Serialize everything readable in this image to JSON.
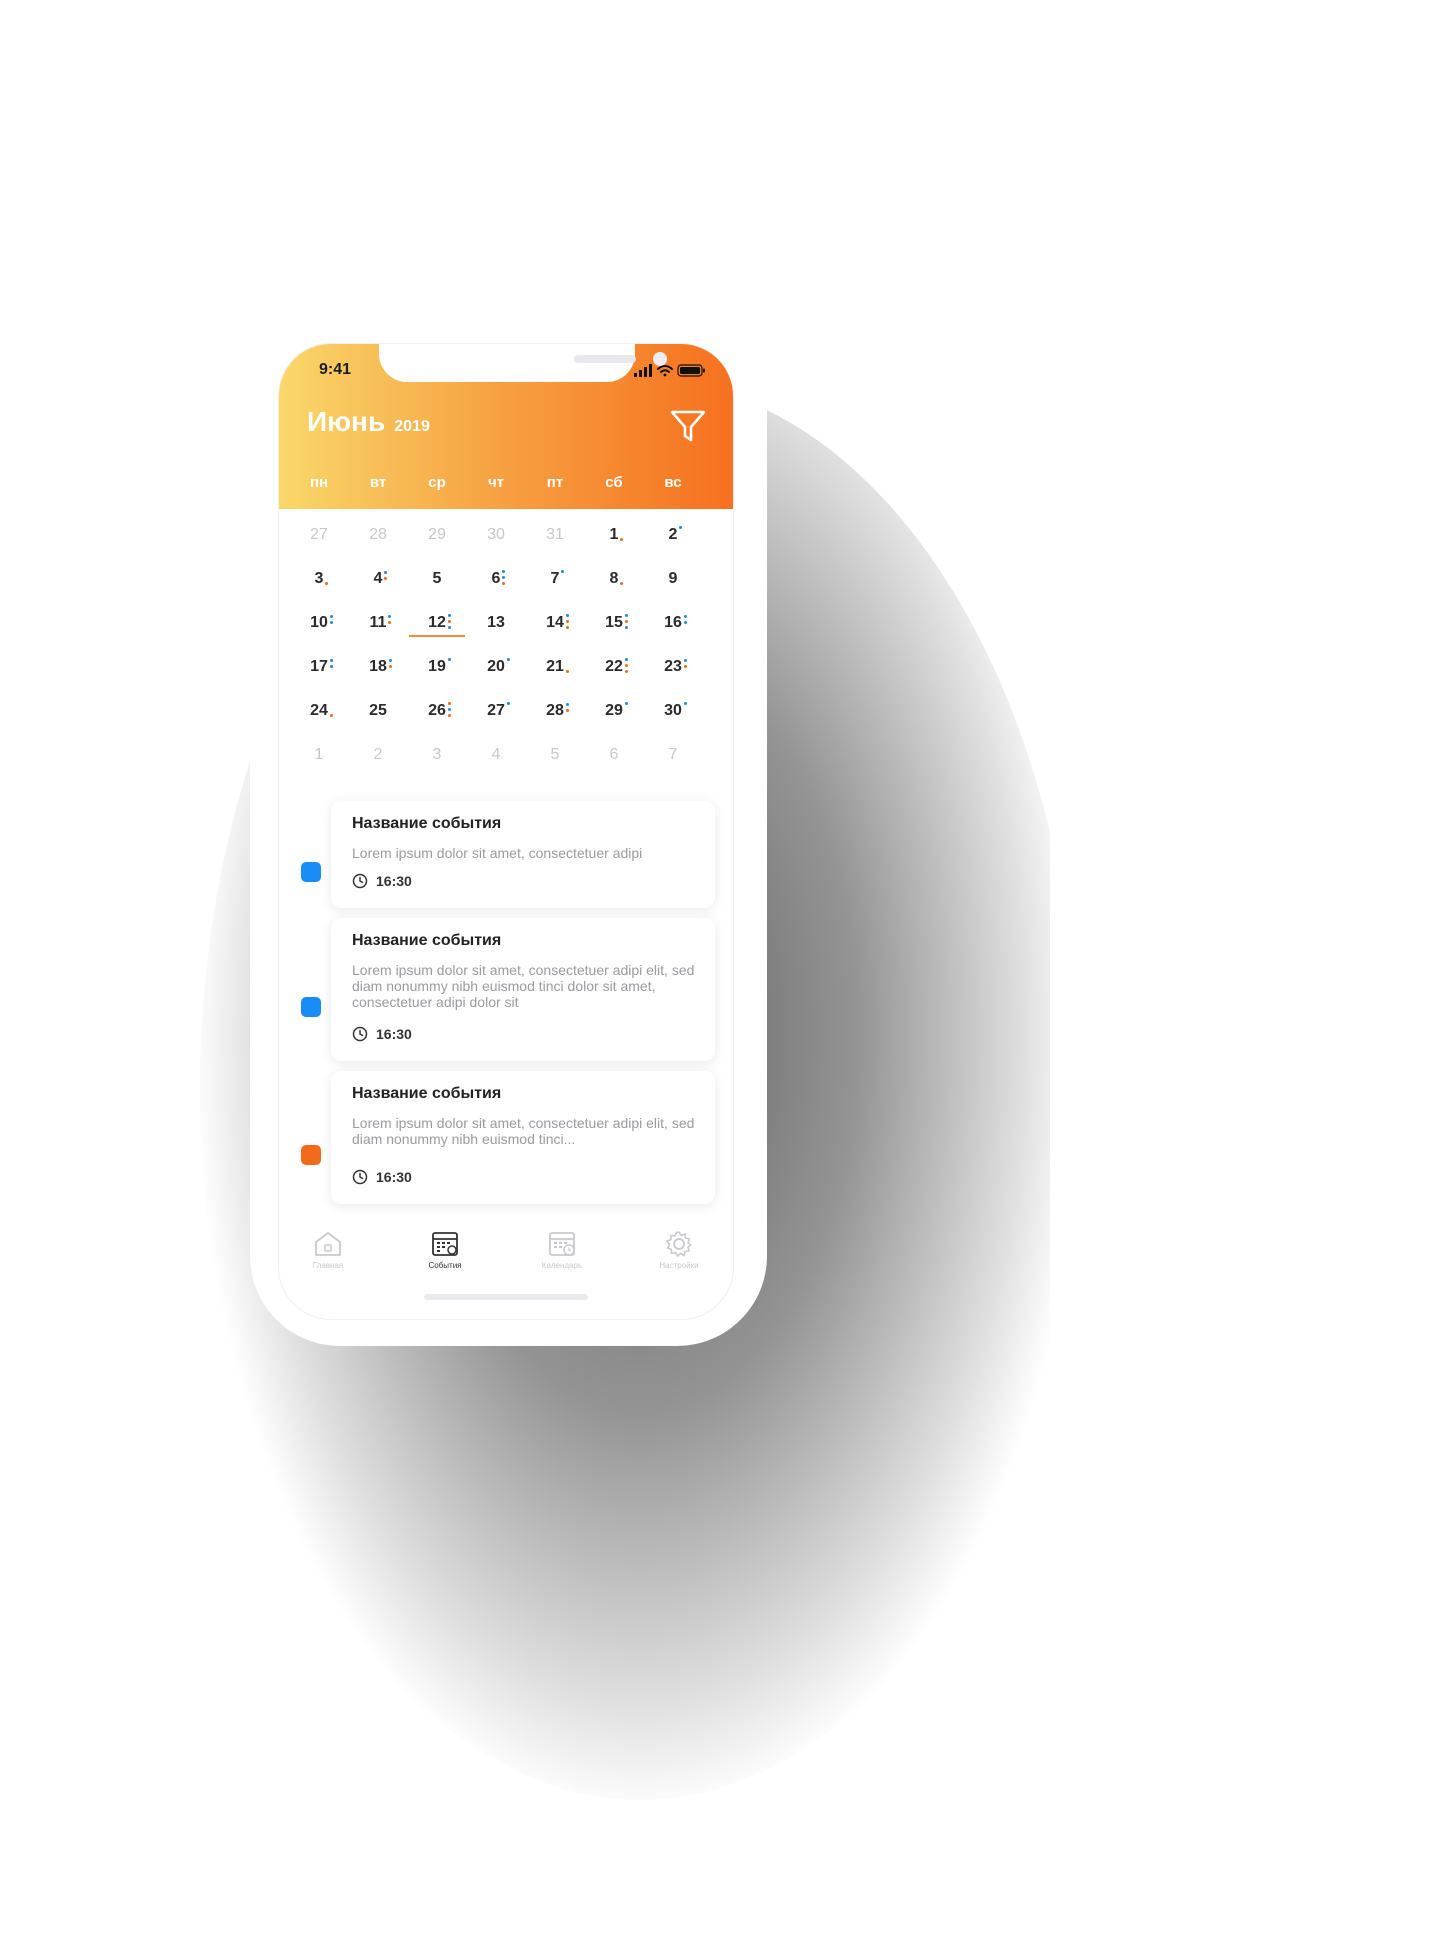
{
  "status_bar": {
    "time": "9:41"
  },
  "header": {
    "month": "Июнь",
    "year": "2019",
    "weekdays": [
      "пн",
      "вт",
      "ср",
      "чт",
      "пт",
      "сб",
      "вс"
    ]
  },
  "colors": {
    "blue": "#1a8cf5",
    "orange": "#f26b1d",
    "accent_gradient": [
      "#f9d86a",
      "#f6701f"
    ]
  },
  "calendar": {
    "rows": [
      [
        "27",
        "28",
        "29",
        "30",
        "31",
        "1",
        "2"
      ],
      [
        "3",
        "4",
        "5",
        "6",
        "7",
        "8",
        "9"
      ],
      [
        "10",
        "11",
        "12",
        "13",
        "14",
        "15",
        "16"
      ],
      [
        "17",
        "18",
        "19",
        "20",
        "21",
        "22",
        "23"
      ],
      [
        "24",
        "25",
        "26",
        "27",
        "28",
        "29",
        "30"
      ],
      [
        "1",
        "2",
        "3",
        "4",
        "5",
        "6",
        "7"
      ]
    ],
    "selected_day": "12"
  },
  "events": [
    {
      "title": "Название события",
      "description": "Lorem ipsum dolor sit amet, consectetuer adipi",
      "time": "16:30",
      "color": "#1a8cf5"
    },
    {
      "title": "Название события",
      "description": "Lorem ipsum dolor sit amet, consectetuer adipi elit, sed diam nonummy nibh euismod tinci dolor sit amet, consectetuer adipi dolor sit",
      "time": "16:30",
      "color": "#1a8cf5"
    },
    {
      "title": "Название события",
      "description": "Lorem ipsum dolor sit amet, consectetuer adipi elit, sed diam nonummy nibh euismod tinci...",
      "time": "16:30",
      "color": "#f26b1d"
    }
  ],
  "tabbar": {
    "items": [
      {
        "label": "Главная",
        "icon": "home-icon",
        "active": false
      },
      {
        "label": "События",
        "icon": "events-calendar-icon",
        "active": true
      },
      {
        "label": "Календарь",
        "icon": "calendar-clock-icon",
        "active": false
      },
      {
        "label": "Настройки",
        "icon": "gear-icon",
        "active": false
      }
    ]
  }
}
